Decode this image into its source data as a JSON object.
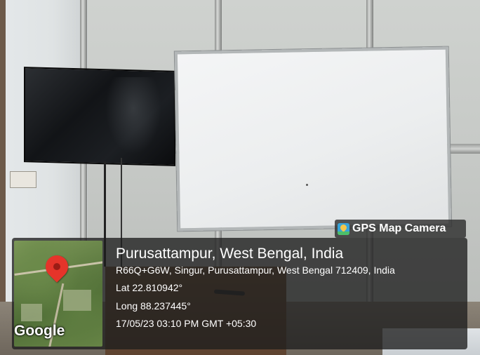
{
  "overlay": {
    "app_name": "GPS Map Camera",
    "app_icon": "gps-map-camera-icon",
    "map_attribution": "Google",
    "location_title": "Purusattampur, West Bengal, India",
    "address": "R66Q+G6W, Singur, Purusattampur, West Bengal 712409, India",
    "latitude": "Lat 22.810942°",
    "longitude": "Long 88.237445°",
    "timestamp": "17/05/23 03:10 PM GMT +05:30"
  },
  "colors": {
    "overlay_bg": "#1e1e1e",
    "pin": "#e5342a",
    "text": "#ffffff"
  }
}
